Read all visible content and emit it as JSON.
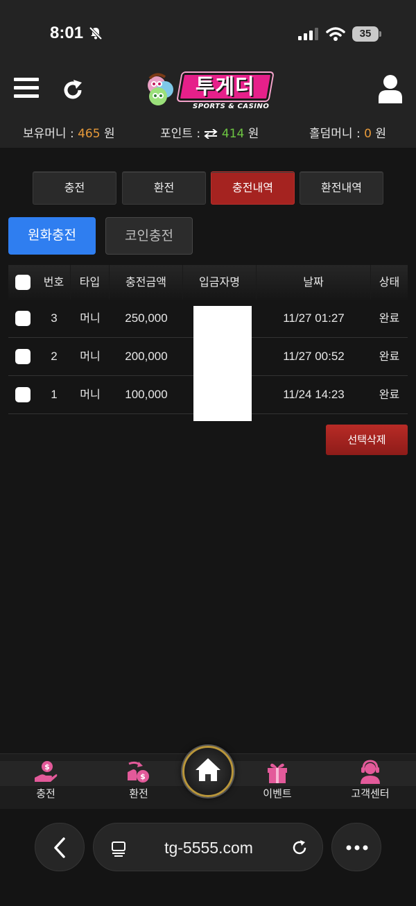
{
  "status_bar": {
    "time": "8:01",
    "battery": "35"
  },
  "header": {
    "logo_text": "투게더",
    "logo_subtitle": "SPORTS & CASINO",
    "balances": {
      "money_label": "보유머니 :",
      "money_value": "465",
      "money_unit": "원",
      "point_label": "포인트 :",
      "point_value": "414",
      "point_unit": "원",
      "hold_label": "홀덤머니 :",
      "hold_value": "0",
      "hold_unit": "원"
    }
  },
  "tabs": [
    "충전",
    "환전",
    "충전내역",
    "환전내역"
  ],
  "active_tab": "충전내역",
  "subtabs": [
    "원화충전",
    "코인충전"
  ],
  "table": {
    "headers": [
      "번호",
      "타입",
      "충전금액",
      "입금자명",
      "날짜",
      "상태"
    ],
    "rows": [
      {
        "no": "3",
        "type": "머니",
        "amount": "250,000",
        "depositor": "",
        "date": "11/27 01:27",
        "status": "완료"
      },
      {
        "no": "2",
        "type": "머니",
        "amount": "200,000",
        "depositor": "",
        "date": "11/27 00:52",
        "status": "완료"
      },
      {
        "no": "1",
        "type": "머니",
        "amount": "100,000",
        "depositor": "",
        "date": "11/24 14:23",
        "status": "완료"
      }
    ]
  },
  "delete_button": "선택삭제",
  "bottom_nav": [
    {
      "label": "충전",
      "icon": "hand-coin-icon"
    },
    {
      "label": "환전",
      "icon": "exchange-coin-icon"
    },
    {
      "label": "",
      "icon": "home-icon"
    },
    {
      "label": "이벤트",
      "icon": "gift-icon"
    },
    {
      "label": "고객센터",
      "icon": "headset-support-icon"
    }
  ],
  "browser": {
    "url": "tg-5555.com"
  },
  "colors": {
    "accent_red": "#a52320",
    "accent_blue": "#2f7ef0",
    "money_orange": "#e79a3a",
    "point_green": "#6dc542",
    "icon_pink": "#e35a9a"
  }
}
